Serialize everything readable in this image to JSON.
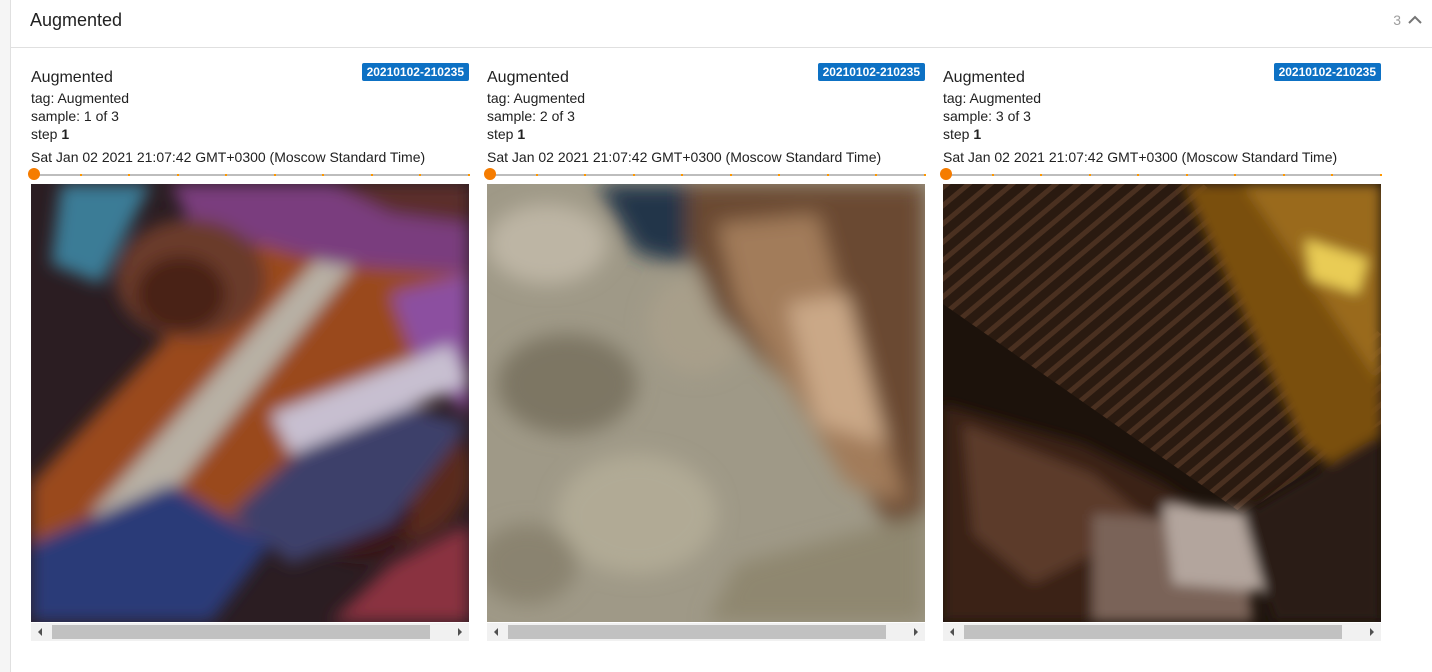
{
  "pane": {
    "title": "Augmented",
    "count": "3",
    "collapse_icon": "chevron-up-icon"
  },
  "cards": [
    {
      "title": "Augmented",
      "run": "20210102-210235",
      "tag_label": "tag: ",
      "tag": "Augmented",
      "sample_label": "sample: ",
      "sample": "1 of 3",
      "step_label": "step ",
      "step": "1",
      "timestamp": "Sat Jan 02 2021 21:07:42 GMT+0300 (Moscow Standard Time)",
      "slider_value": 0
    },
    {
      "title": "Augmented",
      "run": "20210102-210235",
      "tag_label": "tag: ",
      "tag": "Augmented",
      "sample_label": "sample: ",
      "sample": "2 of 3",
      "step_label": "step ",
      "step": "1",
      "timestamp": "Sat Jan 02 2021 21:07:42 GMT+0300 (Moscow Standard Time)",
      "slider_value": 0
    },
    {
      "title": "Augmented",
      "run": "20210102-210235",
      "tag_label": "tag: ",
      "tag": "Augmented",
      "sample_label": "sample: ",
      "sample": "3 of 3",
      "step_label": "step ",
      "step": "1",
      "timestamp": "Sat Jan 02 2021 21:07:42 GMT+0300 (Moscow Standard Time)",
      "slider_value": 0
    }
  ],
  "colors": {
    "run_badge": "#0d71c4",
    "slider_thumb": "#f57c00",
    "slider_tick": "#ff9800"
  }
}
